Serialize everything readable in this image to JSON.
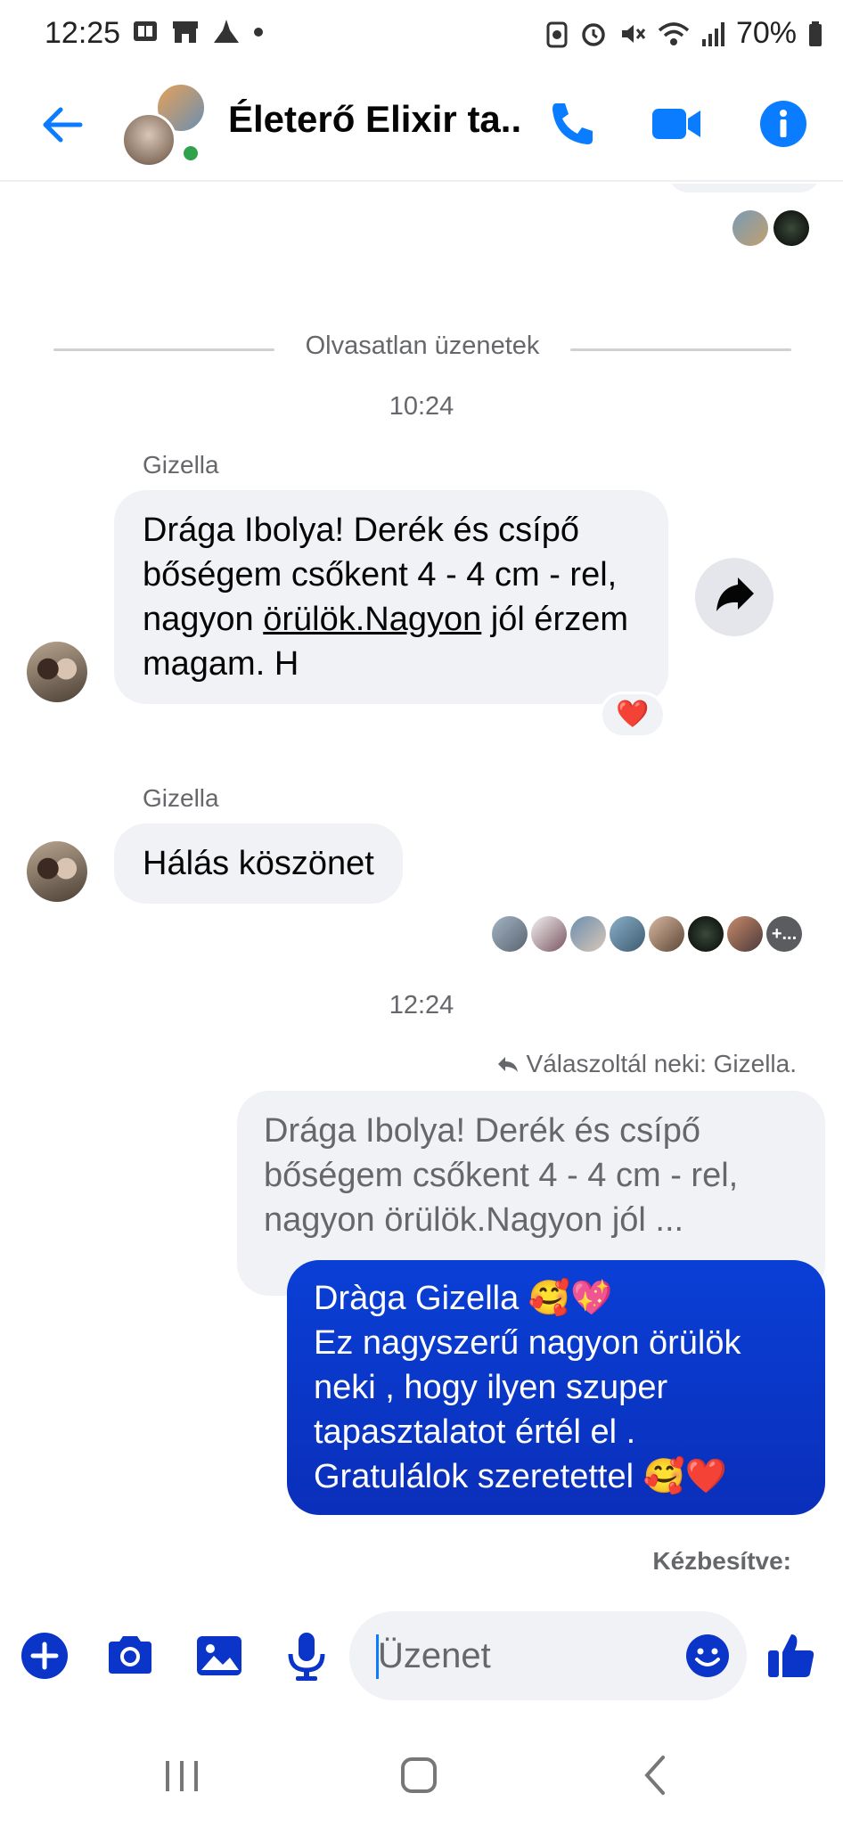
{
  "status_bar": {
    "time": "12:25",
    "battery": "70%"
  },
  "header": {
    "title": "Életerő Elixir ta..."
  },
  "chat": {
    "unread_divider": "Olvasatlan üzenetek",
    "time_1": "10:24",
    "msg1": {
      "sender": "Gizella",
      "text_before_link": "Drága Ibolya! Derék és csípő bőségem csőkent 4 - 4 cm - rel, nagyon ",
      "link_text": "örülök.Nagyon",
      "text_after_link": " jól érzem magam. H",
      "reaction": "❤️"
    },
    "msg2": {
      "sender": "Gizella",
      "text": "Hálás köszönet"
    },
    "time_2": "12:24",
    "reply_note": "Válaszoltál neki: Gizella.",
    "quoted_text": "Drága Ibolya! Derék és csípő bőségem csőkent 4 - 4 cm - rel, nagyon örülök.Nagyon jól ...",
    "outgoing": {
      "line1": "Dràga Gizella 🥰💖",
      "line2": "Ez nagyszerű nagyon örülök neki , hogy ilyen szuper tapasztalatot értél el .",
      "line3": "Gratulálok szeretettel 🥰❤️"
    },
    "delivered": "Kézbesítve:",
    "seen_more": "+..."
  },
  "composer": {
    "placeholder": "Üzenet"
  },
  "colors": {
    "accent": "#0a7cff",
    "outgoing_bubble": "#0a35c8",
    "incoming_bubble": "#f0f2f5",
    "online": "#31a24c"
  }
}
